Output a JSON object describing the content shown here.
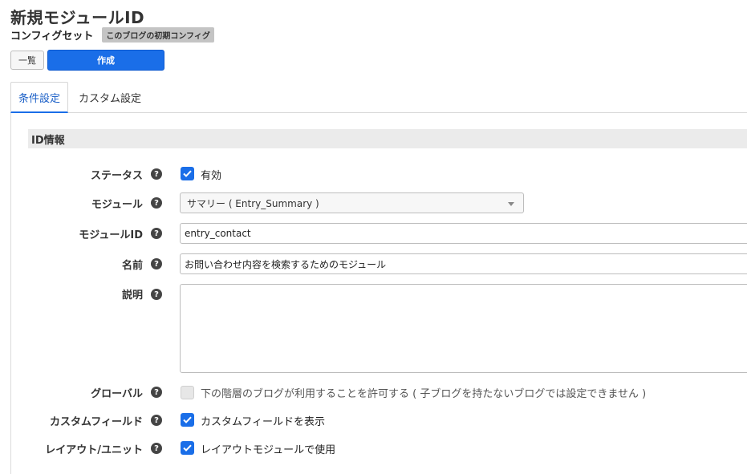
{
  "header": {
    "title": "新規モジュールID",
    "config_label": "コンフィグセット",
    "config_badge": "このブログの初期コンフィグ"
  },
  "toolbar": {
    "list_label": "一覧",
    "create_label": "作成"
  },
  "tabs": [
    {
      "label": "条件設定",
      "active": true
    },
    {
      "label": "カスタム設定",
      "active": false
    }
  ],
  "section": {
    "title": "ID情報"
  },
  "form": {
    "status": {
      "label": "ステータス",
      "checkbox_label": "有効",
      "checked": true
    },
    "module": {
      "label": "モジュール",
      "selected": "サマリー ( Entry_Summary )"
    },
    "module_id": {
      "label": "モジュールID",
      "value": "entry_contact"
    },
    "name": {
      "label": "名前",
      "value": "お問い合わせ内容を検索するためのモジュール"
    },
    "description": {
      "label": "説明",
      "value": ""
    },
    "global": {
      "label": "グローバル",
      "checkbox_label": "下の階層のブログが利用することを許可する ( 子ブログを持たないブログでは設定できません )",
      "checked": false,
      "disabled": true
    },
    "custom_field": {
      "label": "カスタムフィールド",
      "checkbox_label": "カスタムフィールドを表示",
      "checked": true
    },
    "layout_unit": {
      "label": "レイアウト/ユニット",
      "checkbox_label": "レイアウトモジュールで使用",
      "checked": true
    }
  },
  "icons": {
    "help": "question-circle-icon",
    "check": "checkmark-icon",
    "caret": "caret-down-icon"
  },
  "colors": {
    "primary": "#1a6ee8",
    "tab_active_text": "#1a5fc7",
    "section_bg": "#ebebeb"
  }
}
